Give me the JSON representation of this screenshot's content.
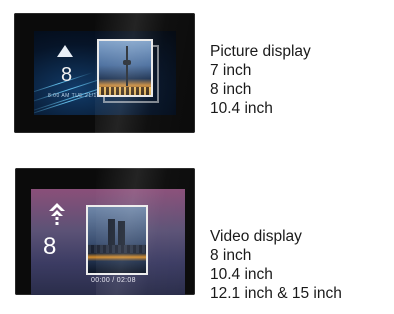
{
  "products": [
    {
      "title": "Picture display",
      "sizes": [
        "7 inch",
        "8 inch",
        "10.4 inch"
      ],
      "screen": {
        "number": "8",
        "tiny_text": "8:00 AM  TUE 21/10"
      }
    },
    {
      "title": "Video display",
      "sizes": [
        "8 inch",
        "10.4 inch",
        "12.1 inch & 15 inch"
      ],
      "screen": {
        "number": "8",
        "time": "00:00 / 02:08"
      }
    }
  ],
  "icons": {
    "frame1_logo": "triangle-logo-icon",
    "frame2_logo": "arrow-logo-icon"
  }
}
